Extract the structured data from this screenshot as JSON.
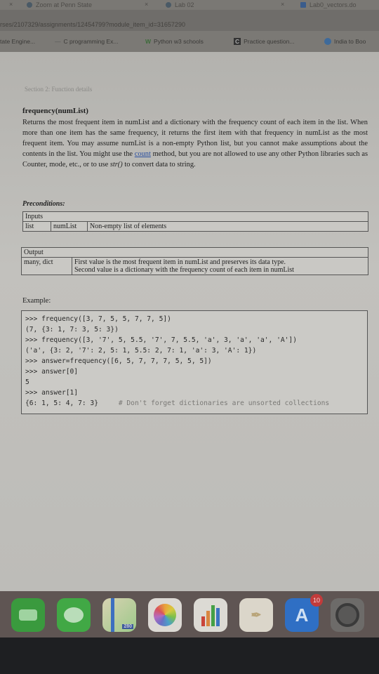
{
  "browser": {
    "tabs": [
      {
        "title": "Zoom at Penn State"
      },
      {
        "title": "Lab 02"
      },
      {
        "title": "Lab0_vectors.do"
      }
    ],
    "close_glyph": "×",
    "url": "rses/2107329/assignments/12454799?module_item_id=31657290",
    "bookmarks": [
      {
        "label": "tate Engine..."
      },
      {
        "label": "C programming Ex..."
      },
      {
        "label": "Python w3 schools"
      },
      {
        "label": "Practice question..."
      },
      {
        "label": "India to Boo"
      }
    ]
  },
  "doc": {
    "section_title": "Section 2: Function details",
    "function_name": "frequency(numList)",
    "description_before_link": "Returns the most frequent item in numList and a dictionary with the frequency count of each item in the list. When more than one item has the same frequency, it returns the first item with that frequency in numList as the most frequent item. You may assume numList is a non-empty Python list, but you cannot make assumptions about the contents in the list. You might use the ",
    "description_link": "count",
    "description_after_link": " method, but you are not allowed to use any other Python libraries such as Counter, mode, etc., or to use ",
    "description_str": "str()",
    "description_end": " to convert data to string.",
    "preconditions_label": "Preconditions:",
    "inputs": {
      "header": "Inputs",
      "type": "list",
      "name": "numList",
      "desc": "Non-empty list of elements"
    },
    "output": {
      "header": "Output",
      "type": "many, dict",
      "desc_line1": "First value is the most frequent item in numList and preserves its data type.",
      "desc_line2": "Second value is a dictionary with the frequency count of each item in numList"
    },
    "example_label": "Example:",
    "code_lines": [
      ">>> frequency([3, 7, 5, 5, 7, 7, 5])",
      "(7, {3: 1, 7: 3, 5: 3})",
      ">>> frequency([3, '7', 5, 5.5, '7', 7, 5.5, 'a', 3, 'a', 'a', 'A'])",
      "('a', {3: 2, '7': 2, 5: 1, 5.5: 2, 7: 1, 'a': 3, 'A': 1})",
      ">>> answer=frequency([6, 5, 7, 7, 7, 5, 5, 5])",
      ">>> answer[0]",
      "5",
      ">>> answer[1]",
      "{6: 1, 5: 4, 7: 3}"
    ],
    "code_comment": "# Don't forget dictionaries are unsorted collections"
  },
  "dock": {
    "apps": [
      {
        "name": "FaceTime",
        "color": "#3a9a3e"
      },
      {
        "name": "Messages",
        "color": "#41a845"
      },
      {
        "name": "Maps",
        "color": "#c9c4a8"
      },
      {
        "name": "Photos",
        "color": "#d9d6d1"
      },
      {
        "name": "Numbers",
        "color": "#d8d6d0"
      },
      {
        "name": "Script Editor",
        "color": "#d6d0c2"
      },
      {
        "name": "App Store",
        "color": "#2f6fc4"
      },
      {
        "name": "System Preferences",
        "color": "#6d6b69"
      }
    ],
    "maps_badge": "280",
    "app_store_badge": "10"
  }
}
